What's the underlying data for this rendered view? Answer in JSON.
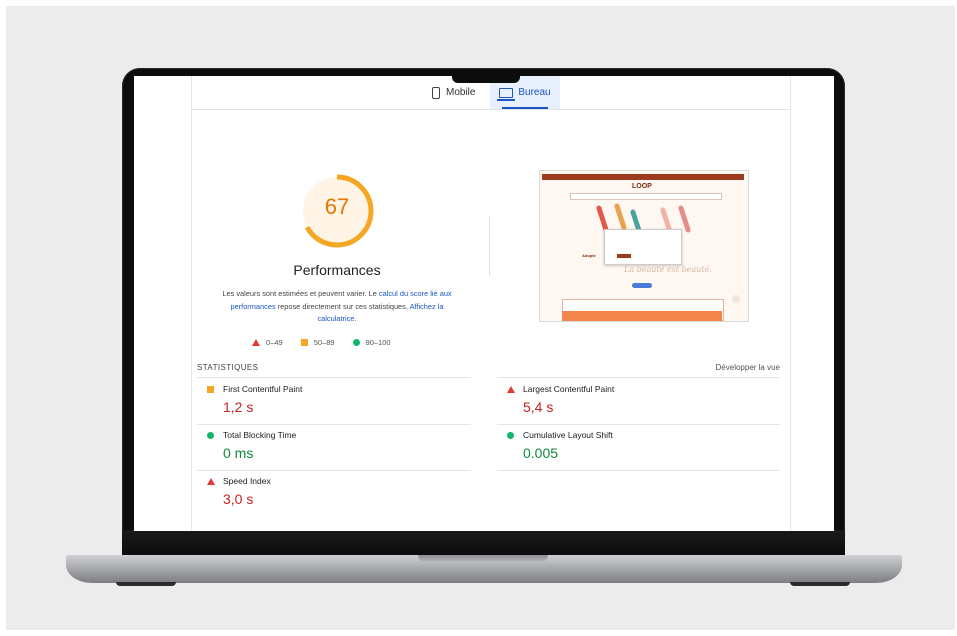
{
  "tabs": {
    "mobile": "Mobile",
    "desktop": "Bureau"
  },
  "score": {
    "value": "67",
    "fraction": 0.67,
    "color": "#f5a623"
  },
  "performance": {
    "title": "Performances",
    "desc_1": "Les valeurs sont estimées et peuvent varier. Le ",
    "desc_link_1": "calcul du score lié aux performances",
    "desc_2": " repose directement sur ces statistiques. ",
    "desc_link_2": "Affichez la calculatrice",
    "desc_3": "."
  },
  "legend": {
    "fail": "0–49",
    "average": "50–89",
    "pass": "90–100"
  },
  "thumbnail": {
    "brand": "LOOP",
    "heading": "Adopte ",
    "slogan": "La beauté est beauté."
  },
  "stats": {
    "header": "STATISTIQUES",
    "expand": "Développer la vue",
    "metrics": [
      {
        "label": "First Contentful Paint",
        "value": "1,2 s",
        "rating": "average"
      },
      {
        "label": "Largest Contentful Paint",
        "value": "5,4 s",
        "rating": "fail"
      },
      {
        "label": "Total Blocking Time",
        "value": "0 ms",
        "rating": "pass"
      },
      {
        "label": "Cumulative Layout Shift",
        "value": "0.005",
        "rating": "pass"
      },
      {
        "label": "Speed Index",
        "value": "3,0 s",
        "rating": "fail"
      }
    ]
  },
  "colors": {
    "fail": "#e53935",
    "average": "#f5a623",
    "pass": "#12b76a",
    "link": "#1a56c4"
  }
}
